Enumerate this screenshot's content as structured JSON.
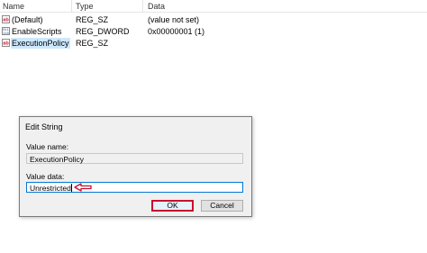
{
  "list": {
    "headers": {
      "name": "Name",
      "type": "Type",
      "data": "Data"
    },
    "rows": [
      {
        "icon": "string-value-icon",
        "name": "(Default)",
        "type": "REG_SZ",
        "data": "(value not set)"
      },
      {
        "icon": "binary-value-icon",
        "name": "EnableScripts",
        "type": "REG_DWORD",
        "data": "0x00000001 (1)"
      },
      {
        "icon": "string-value-icon",
        "name": "ExecutionPolicy",
        "type": "REG_SZ",
        "data": ""
      }
    ]
  },
  "dialog": {
    "title": "Edit String",
    "value_name_label": "Value name:",
    "value_name": "ExecutionPolicy",
    "value_data_label": "Value data:",
    "value_data": "Unrestricted",
    "ok_label": "OK",
    "cancel_label": "Cancel"
  },
  "colors": {
    "annotation_red": "#c8102e",
    "selection": "#cce8ff",
    "focus_border": "#0078d7"
  }
}
